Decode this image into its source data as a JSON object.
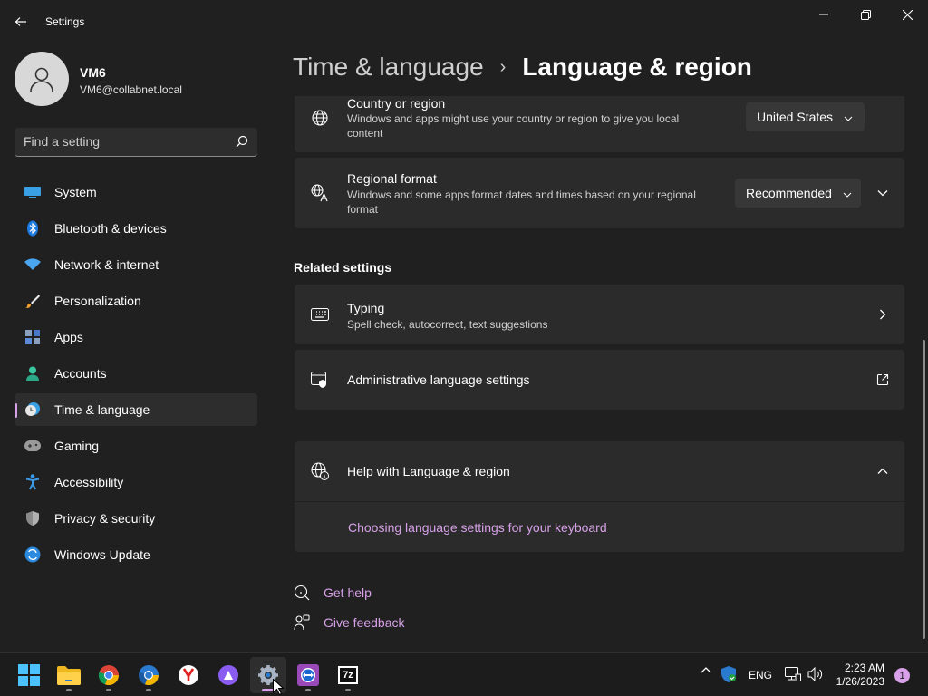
{
  "window": {
    "title": "Settings"
  },
  "profile": {
    "name": "VM6",
    "email": "VM6@collabnet.local"
  },
  "search": {
    "placeholder": "Find a setting"
  },
  "sidebar": {
    "items": [
      {
        "label": "System",
        "icon": "system-icon"
      },
      {
        "label": "Bluetooth & devices",
        "icon": "bluetooth-icon"
      },
      {
        "label": "Network & internet",
        "icon": "wifi-icon"
      },
      {
        "label": "Personalization",
        "icon": "brush-icon"
      },
      {
        "label": "Apps",
        "icon": "apps-icon"
      },
      {
        "label": "Accounts",
        "icon": "person-icon"
      },
      {
        "label": "Time & language",
        "icon": "clock-globe-icon",
        "active": true
      },
      {
        "label": "Gaming",
        "icon": "gamepad-icon"
      },
      {
        "label": "Accessibility",
        "icon": "accessibility-icon"
      },
      {
        "label": "Privacy & security",
        "icon": "shield-icon"
      },
      {
        "label": "Windows Update",
        "icon": "update-icon"
      }
    ]
  },
  "header": {
    "parent": "Time & language",
    "separator": "›",
    "current": "Language & region"
  },
  "country": {
    "title": "Country or region",
    "desc_line1": "Windows and apps might use your country or region to give you local",
    "desc_line2": "content",
    "value": "United States"
  },
  "regional_format": {
    "title": "Regional format",
    "desc_line1": "Windows and some apps format dates and times based on your regional",
    "desc_line2": "format",
    "value": "Recommended"
  },
  "related": {
    "section_title": "Related settings",
    "typing": {
      "title": "Typing",
      "desc": "Spell check, autocorrect, text suggestions"
    },
    "admin": {
      "title": "Administrative language settings"
    }
  },
  "help": {
    "title": "Help with Language & region",
    "link": "Choosing language settings for your keyboard"
  },
  "footer": {
    "get_help": "Get help",
    "give_feedback": "Give feedback"
  },
  "taskbar": {
    "apps": [
      "start",
      "file-explorer",
      "chrome",
      "chromium-browser",
      "yandex-browser",
      "alice-assistant",
      "settings",
      "teamviewer",
      "7zip"
    ],
    "seven_zip_label": "7z",
    "language": "ENG",
    "time": "2:23 AM",
    "date": "1/26/2023",
    "notifications": "1"
  },
  "colors": {
    "accent": "#d7a0e8",
    "background": "#202020",
    "card": "#2b2b2b"
  }
}
